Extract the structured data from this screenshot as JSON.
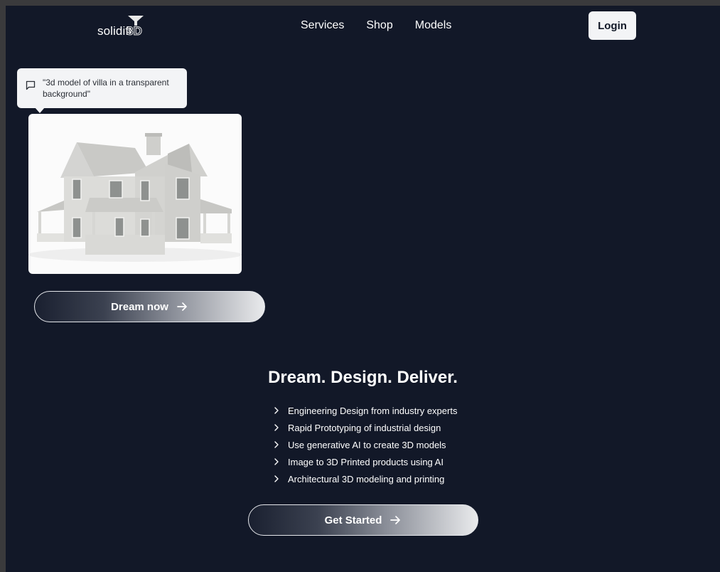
{
  "header": {
    "logo": {
      "text": "solidifi",
      "accent": "3D"
    },
    "nav": [
      "Services",
      "Shop",
      "Models"
    ],
    "login_label": "Login"
  },
  "prompt": {
    "text": "\"3d model of villa in a transparent background\"",
    "icon": "chat-bubble-icon"
  },
  "preview": {
    "icon": "house-render-image"
  },
  "dream_button": {
    "label": "Dream now",
    "icon": "arrow-right-icon"
  },
  "hero": {
    "title": "Dream. Design. Deliver.",
    "features": [
      "Engineering Design from industry experts",
      "Rapid Prototyping of industrial design",
      "Use generative AI to create 3D models",
      "Image to 3D Printed products using AI",
      "Architectural 3D modeling and printing"
    ]
  },
  "start_button": {
    "label": "Get Started",
    "icon": "arrow-right-icon"
  },
  "colors": {
    "background": "#121828",
    "button_light": "#f3f4f6",
    "text": "#ffffff"
  }
}
